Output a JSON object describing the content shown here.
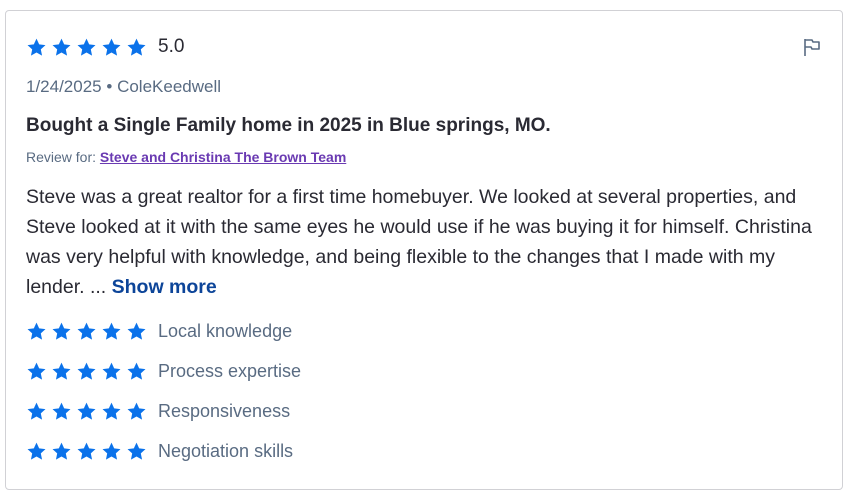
{
  "review": {
    "overall_rating": "5.0",
    "date": "1/24/2025",
    "separator": "•",
    "author": "ColeKeedwell",
    "title": "Bought a Single Family home in 2025 in Blue springs, MO.",
    "review_for_label": "Review for:",
    "agent_name": "Steve and Christina The Brown Team",
    "body": "Steve was a great realtor for a first time homebuyer. We looked at several properties, and Steve looked at it with the same eyes he would use if he was buying it for himself. Christina was very helpful with knowledge, and being flexible to the changes that I made with my lender. ...",
    "show_more_label": "Show more"
  },
  "subratings": [
    {
      "label": "Local knowledge",
      "stars": 5
    },
    {
      "label": "Process expertise",
      "stars": 5
    },
    {
      "label": "Responsiveness",
      "stars": 5
    },
    {
      "label": "Negotiation skills",
      "stars": 5
    }
  ],
  "icons": {
    "star": "star-icon",
    "flag": "flag-icon"
  },
  "colors": {
    "star": "#0b72ea",
    "link": "#6a3ab2",
    "show_more": "#0d4599",
    "muted": "#596b82",
    "text": "#2a2a33"
  }
}
